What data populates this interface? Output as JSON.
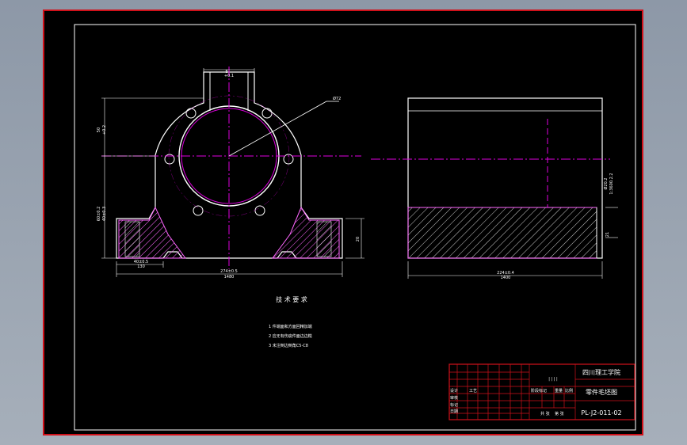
{
  "colors": {
    "sheet": "#000000",
    "border": "#d0111a",
    "outline": "#ffffff",
    "centerline": "#e000e0",
    "hatch": "#ff66ff"
  },
  "front_view": {
    "top_slot_dim": "8",
    "top_slot_dim_sub": "+0.1",
    "left_height_dim": "50",
    "left_height_dim_sub": "+0.2",
    "left_low_dim": "60±0.2",
    "left_low_dim_sub": "40±0.3",
    "right_dim": "20",
    "bottom_left_dim": "40±0.5",
    "bottom_left_dim_sub": "130",
    "bottom_total_dim": "274±0.5",
    "bottom_total_dim_sub": "1480",
    "diameter_leader": "Ø72"
  },
  "side_view": {
    "right_dim": "Ø20.2",
    "right_dim_sub": "1:3600.2.2",
    "right_low_dim": "21",
    "bottom_dim": "224±0.4",
    "bottom_dim_sub": "1400"
  },
  "notes": {
    "title": "技 术 要 求",
    "items": [
      "1  件端面和方面回精加端",
      "2  应无有伤疵件面边边糙",
      "3  未注倒边倒角C5-C8"
    ]
  },
  "title_block": {
    "scale_marks": "| | | |",
    "school": "四川理工学院",
    "drawing_name": "零件毛坯图",
    "drawing_code": "PL-J2-011-02",
    "row_labels": [
      "设计",
      "审核",
      "工艺",
      "标记",
      "日期"
    ],
    "mid_labels": [
      "阶段标记",
      "重量",
      "比例"
    ],
    "bottom_labels": [
      "共 张",
      "第 张"
    ]
  }
}
